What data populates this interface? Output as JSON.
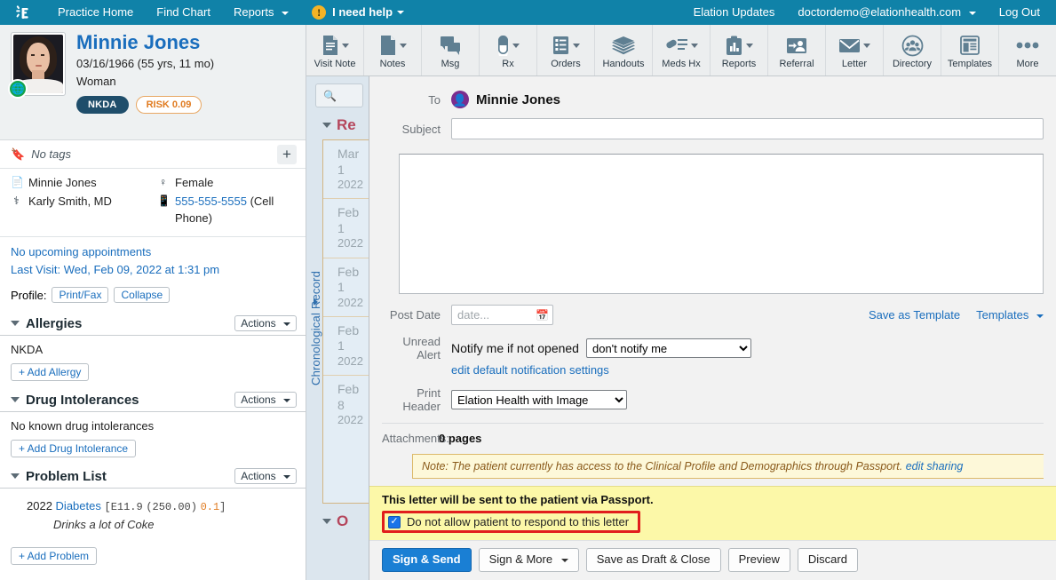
{
  "topnav": {
    "logo_icon": "elation-logo-icon",
    "items": [
      {
        "label": "Practice Home",
        "caret": false
      },
      {
        "label": "Find Chart",
        "caret": false
      },
      {
        "label": "Reports",
        "caret": true
      }
    ],
    "help": {
      "badge": "!",
      "label": "I need help",
      "caret": true
    },
    "right": [
      {
        "label": "Elation Updates",
        "caret": false
      },
      {
        "label": "doctordemo@elationhealth.com",
        "caret": true
      },
      {
        "label": "Log Out",
        "caret": false
      }
    ]
  },
  "patient": {
    "name": "Minnie Jones",
    "dob_line": "03/16/1966 (55 yrs, 11 mo)",
    "sex_line": "Woman",
    "badges": [
      {
        "label": "NKDA",
        "style": "solid",
        "color": "#1f4e6b"
      },
      {
        "label": "RISK 0.09",
        "style": "outline",
        "color": "#e07b20"
      }
    ],
    "globe_icon": "globe-icon",
    "tags": {
      "icon": "tag-icon",
      "text": "No tags",
      "add_icon": "plus-icon"
    },
    "info": {
      "name_row": "Minnie Jones",
      "provider_row": "Karly Smith, MD",
      "sex_row": "Female",
      "phone": "555-555-5555",
      "phone_suffix": "(Cell Phone)"
    },
    "appointments": "No upcoming appointments",
    "last_visit": "Last Visit: Wed, Feb 09, 2022 at 1:31 pm",
    "profile_label": "Profile:",
    "profile_buttons": [
      "Print/Fax",
      "Collapse"
    ]
  },
  "sections": [
    {
      "title": "Allergies",
      "actions_label": "Actions",
      "body": "NKDA",
      "add_label": "+ Add Allergy"
    },
    {
      "title": "Drug Intolerances",
      "actions_label": "Actions",
      "body": "No known drug intolerances",
      "add_label": "+ Add Drug Intolerance"
    },
    {
      "title": "Problem List",
      "actions_label": "Actions",
      "add_label": "+ Add Problem",
      "problem": {
        "year": "2022",
        "name": "Diabetes",
        "code_open": "[",
        "icd10": "E11.9",
        "icd9": "(250.00)",
        "score": "0.1",
        "code_close": "]",
        "note": "Drinks a lot of Coke"
      }
    }
  ],
  "toolbar": {
    "items": [
      {
        "label": "Visit Note",
        "icon": "visit-note-icon",
        "caret": true
      },
      {
        "label": "Notes",
        "icon": "notes-icon",
        "caret": true
      },
      {
        "label": "Msg",
        "icon": "message-icon",
        "caret": false
      },
      {
        "label": "Rx",
        "icon": "pill-icon",
        "caret": true
      },
      {
        "label": "Orders",
        "icon": "orders-list-icon",
        "caret": true
      },
      {
        "label": "Handouts",
        "icon": "handouts-stack-icon",
        "caret": false
      },
      {
        "label": "Meds Hx",
        "icon": "meds-history-icon",
        "caret": true
      },
      {
        "label": "Reports",
        "icon": "reports-chart-icon",
        "caret": true
      },
      {
        "label": "Referral",
        "icon": "referral-person-icon",
        "caret": false
      },
      {
        "label": "Letter",
        "icon": "envelope-icon",
        "caret": true
      },
      {
        "label": "Directory",
        "icon": "directory-people-icon",
        "caret": false
      },
      {
        "label": "Templates",
        "icon": "templates-layout-icon",
        "caret": false
      },
      {
        "label": "More",
        "icon": "more-dots-icon",
        "caret": false
      }
    ]
  },
  "chrono": {
    "search_icon": "search-icon",
    "search_placeholder": "",
    "header_label": "Re",
    "vertical_label": "Chronological Record",
    "footer_label": "O",
    "entries": [
      {
        "month": "Mar 1",
        "year": "2022"
      },
      {
        "month": "Feb 1",
        "year": "2022"
      },
      {
        "month": "Feb 1",
        "year": "2022"
      },
      {
        "month": "Feb 1",
        "year": "2022"
      },
      {
        "month": "Feb 8",
        "year": "2022"
      }
    ]
  },
  "letter": {
    "to_label": "To",
    "to_avatar_icon": "person-avatar-icon",
    "to_name": "Minnie Jones",
    "subject_label": "Subject",
    "subject_value": "",
    "subject_placeholder": "",
    "body_value": "",
    "post_date_label": "Post Date",
    "post_date_placeholder": "date...",
    "calendar_icon": "calendar-icon",
    "save_as_template": "Save as Template",
    "templates_link": "Templates",
    "unread_alert_label": "Unread Alert",
    "notify_text": "Notify me if not opened",
    "notify_selected": "don't notify me",
    "notify_options": [
      "don't notify me"
    ],
    "edit_notification_link": "edit default notification settings",
    "print_header_label": "Print Header",
    "print_header_selected": "Elation Health with Image",
    "print_header_options": [
      "Elation Health with Image"
    ],
    "attachments_label": "Attachments:",
    "attachments_value": "0 pages",
    "note_text": "Note: The patient currently has access to the Clinical Profile and Demographics through Passport.",
    "note_link": "edit sharing",
    "passport_title": "This letter will be sent to the patient via Passport.",
    "passport_checkbox_label": "Do not allow patient to respond to this letter",
    "passport_checkbox_checked": true,
    "highlight_color": "#e11d1d",
    "buttons": [
      {
        "label": "Sign & Send",
        "primary": true,
        "caret": false
      },
      {
        "label": "Sign & More",
        "primary": false,
        "caret": true
      },
      {
        "label": "Save as Draft & Close",
        "primary": false,
        "caret": false
      },
      {
        "label": "Preview",
        "primary": false,
        "caret": false
      },
      {
        "label": "Discard",
        "primary": false,
        "caret": false
      }
    ]
  }
}
